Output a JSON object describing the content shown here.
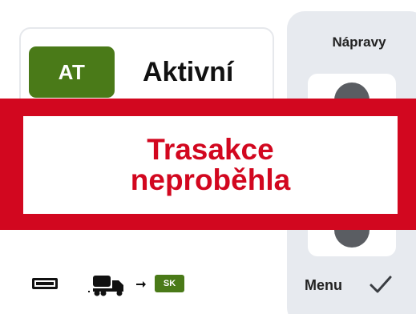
{
  "colors": {
    "alert_red": "#d2071f",
    "badge_green": "#4a7a18",
    "panel_bg": "#e7eaef",
    "knob_gray": "#5a5d62"
  },
  "status": {
    "badge": "AT",
    "label": "Aktivní"
  },
  "axles_panel": {
    "title": "Nápravy",
    "up_icon": "chevron-up-knob-icon",
    "down_icon": "chevron-down-knob-icon"
  },
  "menu": {
    "label": "Menu",
    "confirm_icon": "checkmark-icon"
  },
  "bottom_bar": {
    "card_icon": "card-icon",
    "vehicle_icon": "truck-trailer-icon",
    "arrow_icon": "arrow-right-icon",
    "country_badge": "SK"
  },
  "alert": {
    "line1": "Trasakce",
    "line2": "neproběhla"
  }
}
